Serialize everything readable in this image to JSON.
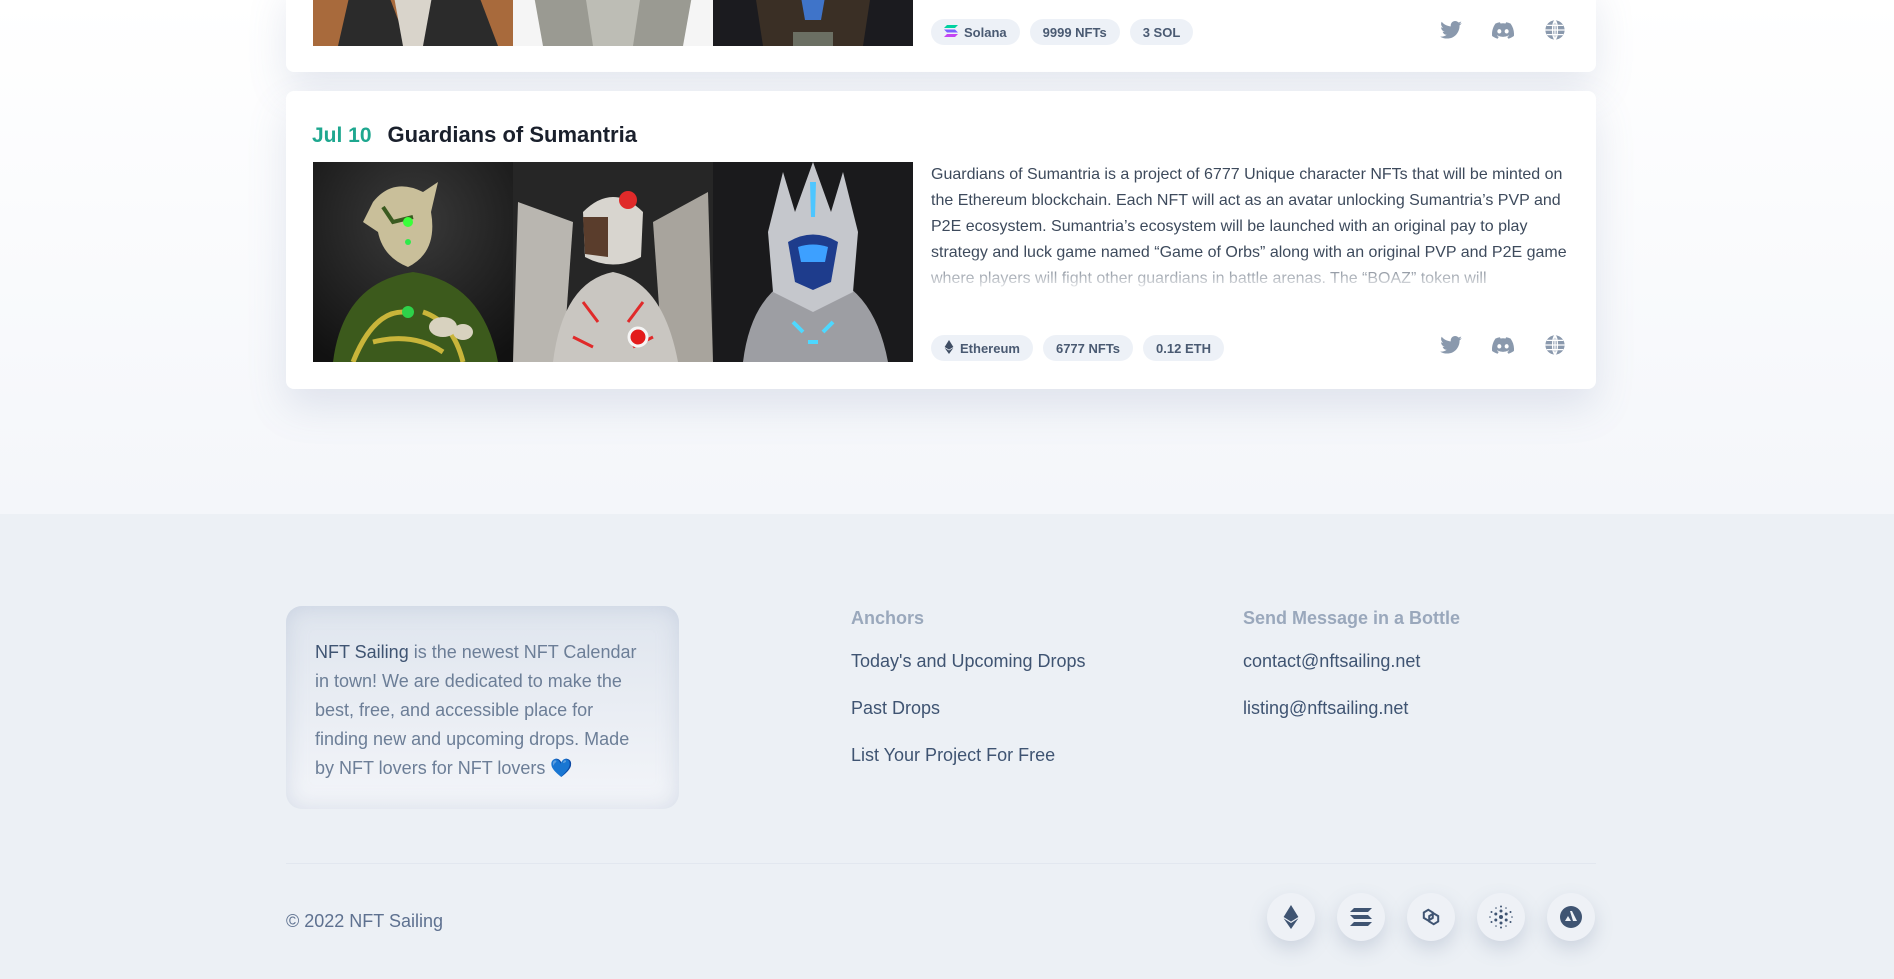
{
  "card_top": {
    "tags": [
      {
        "icon": "solana-icon",
        "label": "Solana"
      },
      {
        "icon": "",
        "label": "9999 NFTs"
      },
      {
        "icon": "",
        "label": "3 SOL"
      }
    ]
  },
  "card_main": {
    "date": "Jul 10",
    "title": "Guardians of Sumantria",
    "description": "Guardians of Sumantria is a project of 6777 Unique character NFTs that will be minted on the Ethereum blockchain. Each NFT will act as an avatar unlocking Sumantria’s PVP and P2E ecosystem. Sumantria’s ecosystem will be launched with an original pay to play strategy and luck game named “Game of Orbs” along with an original PVP and P2E game where players will fight other guardians in battle arenas. The “BOAZ” token will",
    "tags": [
      {
        "icon": "ethereum-icon",
        "label": "Ethereum"
      },
      {
        "icon": "",
        "label": "6777 NFTs"
      },
      {
        "icon": "",
        "label": "0.12 ETH"
      }
    ]
  },
  "socials": [
    "twitter-icon",
    "discord-icon",
    "globe-icon"
  ],
  "footer": {
    "about_brand": "NFT Sailing",
    "about_text": " is the newest NFT Calendar in town! We are dedicated to make the best, free, and accessible place for finding new and upcoming drops. Made by NFT lovers for NFT lovers 💙",
    "anchors_heading": "Anchors",
    "anchors": [
      "Today's and Upcoming Drops",
      "Past Drops",
      "List Your Project For Free"
    ],
    "contact_heading": "Send Message in a Bottle",
    "contacts": [
      "contact@nftsailing.net",
      "listing@nftsailing.net"
    ],
    "copyright": "© 2022 NFT Sailing",
    "chains": [
      "ethereum-icon",
      "solana-icon",
      "polygon-icon",
      "cardano-icon",
      "avalanche-icon"
    ]
  },
  "colors": {
    "accent": "#1ea78f",
    "title": "#1a202c",
    "footer_bg": "#ecf0f5",
    "icon": "#8a99ad"
  }
}
